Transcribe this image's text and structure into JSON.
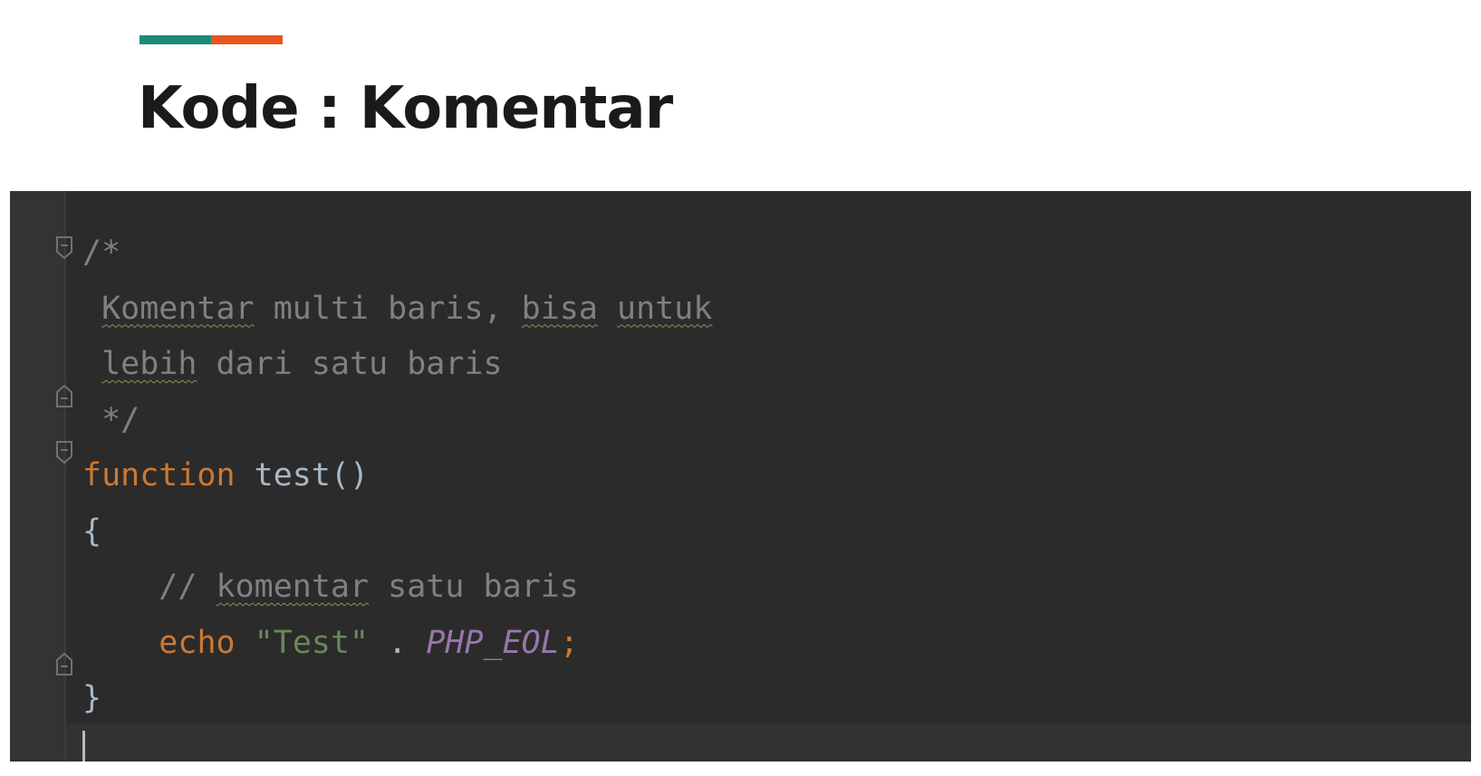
{
  "slide": {
    "title": "Kode : Komentar",
    "accent_colors": [
      "#1f8a7a",
      "#e8561f"
    ]
  },
  "editor": {
    "theme_colors": {
      "background": "#2b2b2b",
      "comment": "#808080",
      "keyword": "#cc7832",
      "string": "#6a8759",
      "constant": "#9876aa"
    },
    "lines": [
      {
        "tokens": [
          {
            "text": "/*",
            "kind": "comment"
          }
        ]
      },
      {
        "tokens": [
          {
            "text": " ",
            "kind": "comment"
          },
          {
            "text": "Komentar",
            "kind": "comment",
            "wavy": true
          },
          {
            "text": " multi baris, ",
            "kind": "comment"
          },
          {
            "text": "bisa",
            "kind": "comment",
            "wavy": true
          },
          {
            "text": " ",
            "kind": "comment"
          },
          {
            "text": "untuk",
            "kind": "comment",
            "wavy": true
          }
        ]
      },
      {
        "tokens": [
          {
            "text": " ",
            "kind": "comment"
          },
          {
            "text": "lebih",
            "kind": "comment",
            "wavy": true
          },
          {
            "text": " dari satu baris",
            "kind": "comment"
          }
        ]
      },
      {
        "tokens": [
          {
            "text": " */",
            "kind": "comment"
          }
        ]
      },
      {
        "tokens": [
          {
            "text": "function",
            "kind": "kw"
          },
          {
            "text": " test()",
            "kind": "fn"
          }
        ]
      },
      {
        "tokens": [
          {
            "text": "{",
            "kind": "fn"
          }
        ]
      },
      {
        "tokens": [
          {
            "text": "    // ",
            "kind": "comment"
          },
          {
            "text": "komentar",
            "kind": "comment",
            "wavy": true
          },
          {
            "text": " satu baris",
            "kind": "comment"
          }
        ]
      },
      {
        "tokens": [
          {
            "text": "    ",
            "kind": "fn"
          },
          {
            "text": "echo",
            "kind": "kw"
          },
          {
            "text": " ",
            "kind": "fn"
          },
          {
            "text": "\"Test\"",
            "kind": "str"
          },
          {
            "text": " . ",
            "kind": "fn"
          },
          {
            "text": "PHP_EOL",
            "kind": "const"
          },
          {
            "text": ";",
            "kind": "semi"
          }
        ]
      },
      {
        "tokens": [
          {
            "text": "}",
            "kind": "fn"
          }
        ]
      }
    ]
  }
}
